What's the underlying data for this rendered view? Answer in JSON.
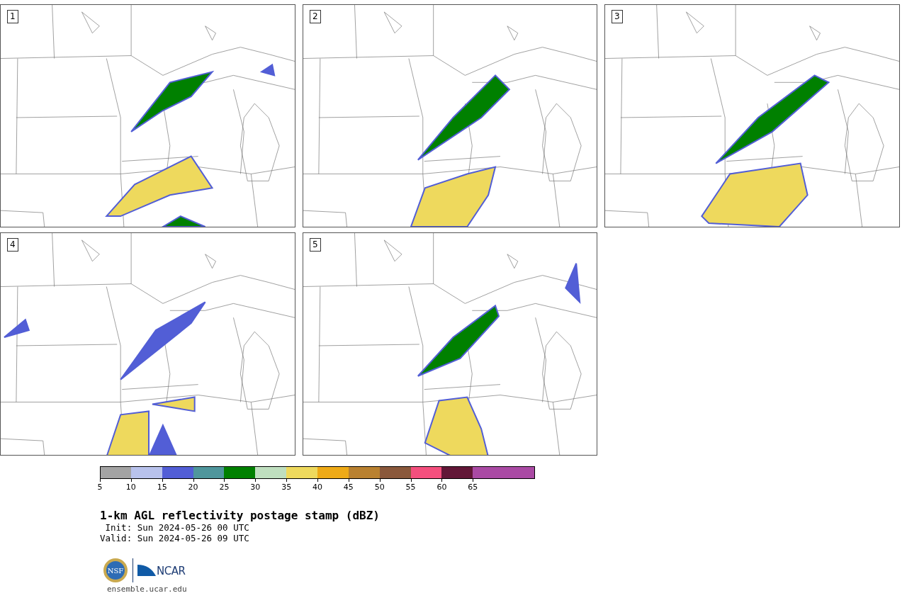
{
  "panels": [
    {
      "label": "1"
    },
    {
      "label": "2"
    },
    {
      "label": "3"
    },
    {
      "label": "4"
    },
    {
      "label": "5"
    }
  ],
  "colorbar": {
    "bins": [
      {
        "color": "#a3a3a3",
        "tick": "5"
      },
      {
        "color": "#b8c2ec",
        "tick": "10"
      },
      {
        "color": "#525ed6",
        "tick": "15"
      },
      {
        "color": "#4f969c",
        "tick": "20"
      },
      {
        "color": "#008000",
        "tick": "25"
      },
      {
        "color": "#bfdfbf",
        "tick": "30"
      },
      {
        "color": "#eed95d",
        "tick": "35"
      },
      {
        "color": "#eeaa17",
        "tick": "40"
      },
      {
        "color": "#b98130",
        "tick": "45"
      },
      {
        "color": "#8a583b",
        "tick": "50"
      },
      {
        "color": "#f44f7d",
        "tick": "55"
      },
      {
        "color": "#621737",
        "tick": "60"
      },
      {
        "color": "#aa4aa4",
        "tick": "65"
      },
      {
        "color": "#aa4aa4"
      }
    ]
  },
  "title": "1-km AGL reflectivity postage stamp (dBZ)",
  "init": " Init: Sun 2024-05-26 00 UTC",
  "valid": "Valid: Sun 2024-05-26 09 UTC",
  "logos": {
    "nsf": "NSF",
    "ncar": "NCAR"
  },
  "url": "ensemble.ucar.edu"
}
